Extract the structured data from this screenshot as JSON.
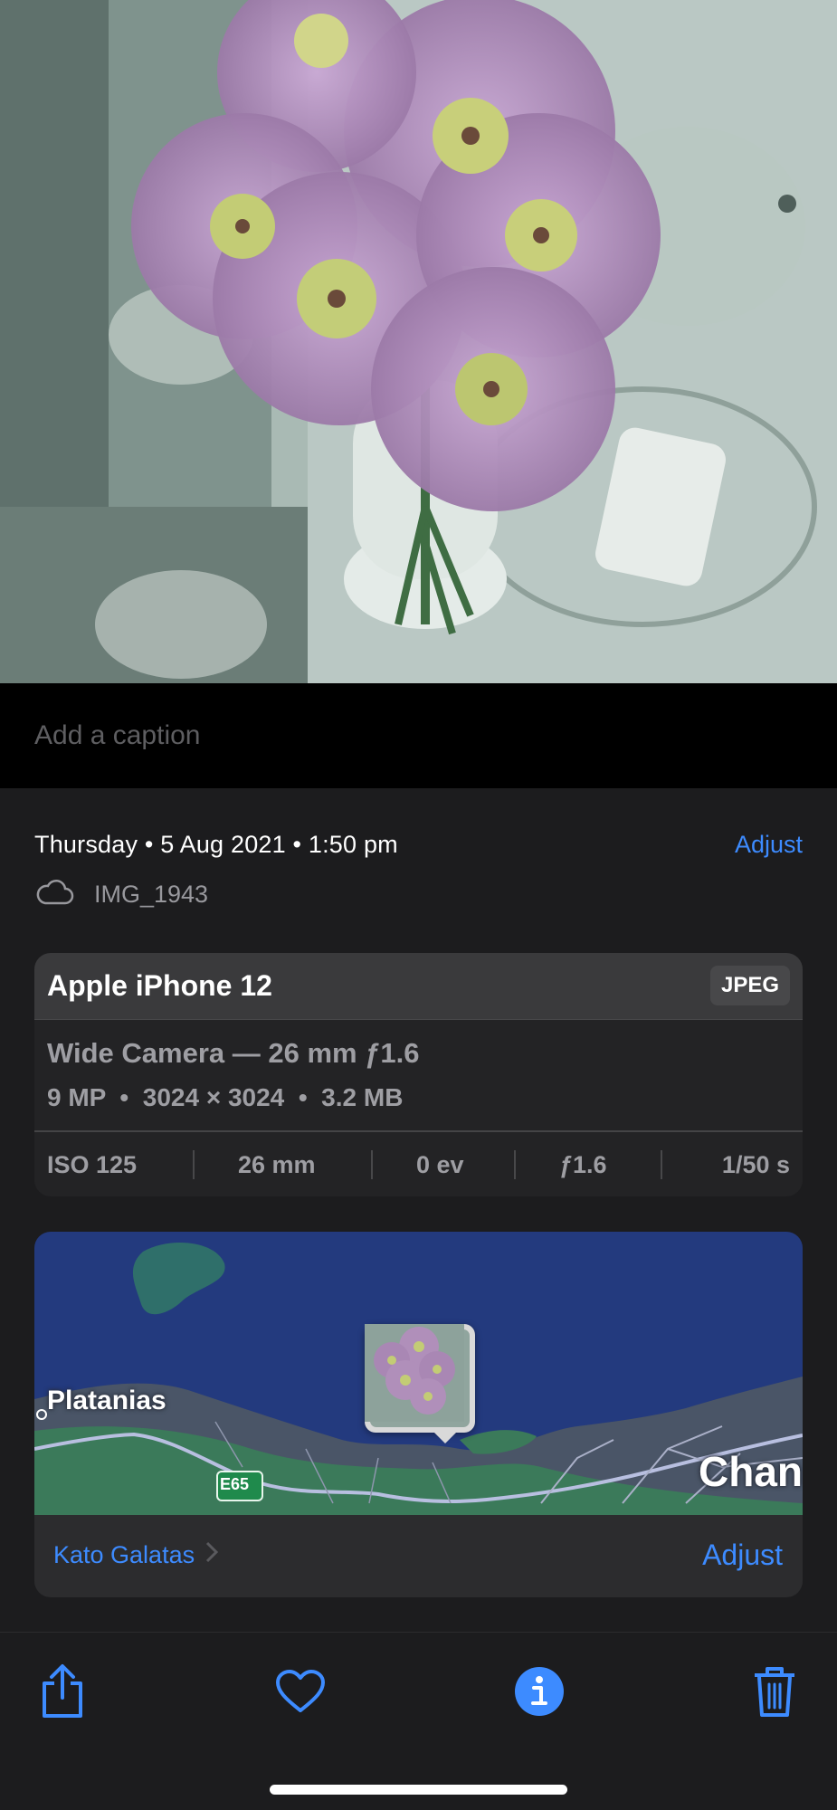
{
  "caption": {
    "placeholder": "Add a caption"
  },
  "info": {
    "date_time": "Thursday • 5 Aug 2021 • 1:50 pm",
    "adjust_label": "Adjust",
    "file_name": "IMG_1943",
    "file_icon": "cloud-icon"
  },
  "camera": {
    "model": "Apple iPhone 12",
    "format": "JPEG",
    "lens": "Wide Camera — 26 mm ƒ1.6",
    "specs": "9 MP  •  3024 × 3024  •  3.2 MB",
    "exif": {
      "iso": "ISO 125",
      "focal": "26 mm",
      "ev": "0 ev",
      "aperture": "ƒ1.6",
      "shutter": "1/50 s"
    }
  },
  "map": {
    "labels": {
      "town_left": "Platanias",
      "town_right": "Chan",
      "road": "E65"
    },
    "location": "Kato Galatas",
    "adjust_label": "Adjust"
  },
  "toolbar": {
    "icons": [
      "share-icon",
      "heart-icon",
      "info-icon",
      "trash-icon"
    ]
  },
  "colors": {
    "accent": "#3d8bff",
    "background": "#1c1c1e",
    "card": "#232325"
  }
}
